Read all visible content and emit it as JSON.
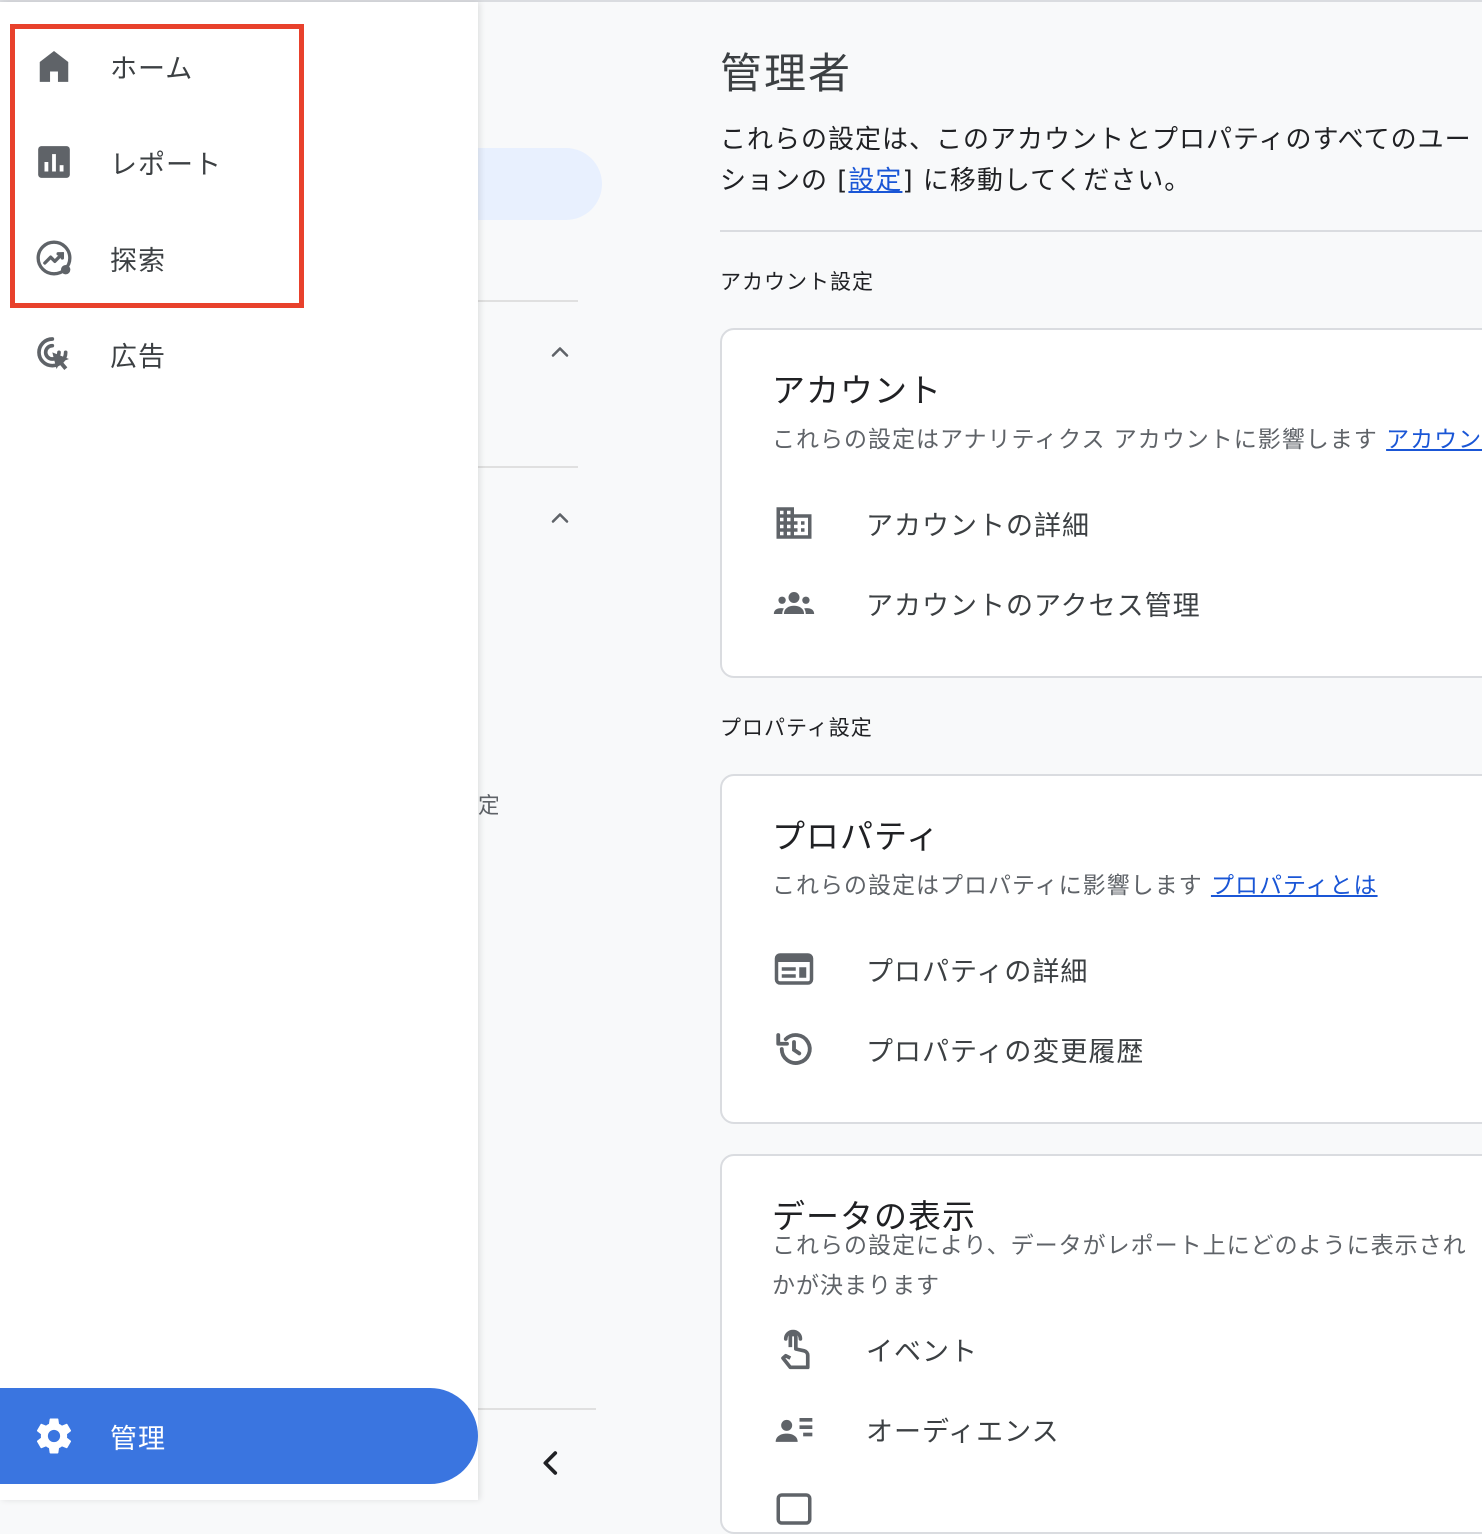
{
  "nav": {
    "items": [
      {
        "label": "ホーム",
        "icon": "home-icon"
      },
      {
        "label": "レポート",
        "icon": "bar-chart-icon"
      },
      {
        "label": "探索",
        "icon": "explore-icon"
      },
      {
        "label": "広告",
        "icon": "ads-cursor-icon"
      }
    ],
    "admin": {
      "label": "管理",
      "icon": "gear-icon"
    }
  },
  "sidebar2": {
    "fragment": "定"
  },
  "main": {
    "title": "管理者",
    "intro_line1": "これらの設定は、このアカウントとプロパティのすべてのユー",
    "intro_line2_prefix": "ションの [",
    "intro_link": "設定",
    "intro_line2_suffix": "] に移動してください。",
    "account_section": {
      "heading": "アカウント設定",
      "card_title": "アカウント",
      "card_desc": "これらの設定はアナリティクス アカウントに影響します",
      "card_link": "アカウン",
      "rows": [
        {
          "label": "アカウントの詳細",
          "icon": "building-icon"
        },
        {
          "label": "アカウントのアクセス管理",
          "icon": "people-icon"
        }
      ]
    },
    "property_section": {
      "heading": "プロパティ設定",
      "card_title": "プロパティ",
      "card_desc": "これらの設定はプロパティに影響します",
      "card_link": "プロパティとは",
      "rows": [
        {
          "label": "プロパティの詳細",
          "icon": "property-details-icon"
        },
        {
          "label": "プロパティの変更履歴",
          "icon": "history-icon"
        }
      ]
    },
    "data_display": {
      "card_title": "データの表示",
      "card_desc_line1": "これらの設定により、データがレポート上にどのように表示され",
      "card_desc_line2": "かが決まります",
      "rows": [
        {
          "label": "イベント",
          "icon": "touch-icon"
        },
        {
          "label": "オーディエンス",
          "icon": "audience-icon"
        }
      ]
    }
  }
}
